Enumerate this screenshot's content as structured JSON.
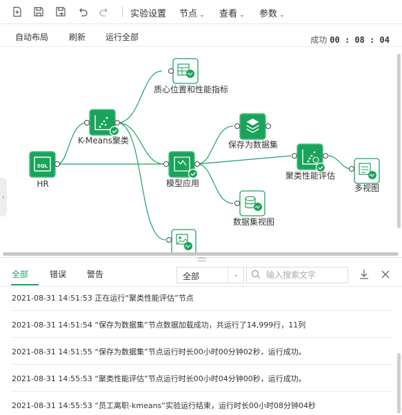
{
  "toolbar": {
    "icons": [
      "new-file-icon",
      "save-icon",
      "save-as-icon",
      "undo-icon",
      "redo-icon"
    ],
    "menus": [
      {
        "label": "实验设置",
        "has_caret": false
      },
      {
        "label": "节点",
        "has_caret": true
      },
      {
        "label": "查看",
        "has_caret": true
      },
      {
        "label": "参数",
        "has_caret": true
      }
    ]
  },
  "subbar": {
    "auto_layout": "自动布局",
    "refresh": "刷新",
    "run_all": "运行全部",
    "status_label": "成功",
    "elapsed": "00 : 08 : 04"
  },
  "canvas": {
    "accent": "#1aa35a",
    "nodes": [
      {
        "id": "hr",
        "label": "HR",
        "icon": "sql-table-icon"
      },
      {
        "id": "kmeans",
        "label": "K-Means聚类",
        "icon": "cluster-scatter-icon",
        "done": true
      },
      {
        "id": "centroid",
        "label": "质心位置和性能指标",
        "icon": "table-chart-icon"
      },
      {
        "id": "model",
        "label": "模型应用",
        "icon": "model-apply-icon",
        "done": true
      },
      {
        "id": "save",
        "label": "保存为数据集",
        "icon": "layers-icon"
      },
      {
        "id": "dataview",
        "label": "数据集视图",
        "icon": "database-chart-icon"
      },
      {
        "id": "eval",
        "label": "聚类性能评估",
        "icon": "cluster-eval-icon",
        "done": true
      },
      {
        "id": "multiview",
        "label": "多视图",
        "icon": "multi-chart-icon"
      },
      {
        "id": "imgview",
        "label": "",
        "icon": "image-chart-icon"
      }
    ]
  },
  "logs": {
    "tabs": [
      "全部",
      "错误",
      "警告"
    ],
    "active_tab": "全部",
    "filter_value": "全部",
    "search_placeholder": "输入搜索文字",
    "entries": [
      "2021-08-31 14:51:53 正在运行“聚类性能评估”节点",
      "2021-08-31 14:51:54 “保存为数据集”节点数据加载成功，共运行了14,999行，11列",
      "2021-08-31 14:51:55 “保存为数据集”节点运行时长00小时00分钟02秒，运行成功。",
      "2021-08-31 14:55:53 “聚类性能评估”节点运行时长00小时04分钟00秒，运行成功。",
      "2021-08-31 14:55:53 “员工离职-kmeans”实验运行结束，运行时长00小时08分钟04秒"
    ]
  }
}
